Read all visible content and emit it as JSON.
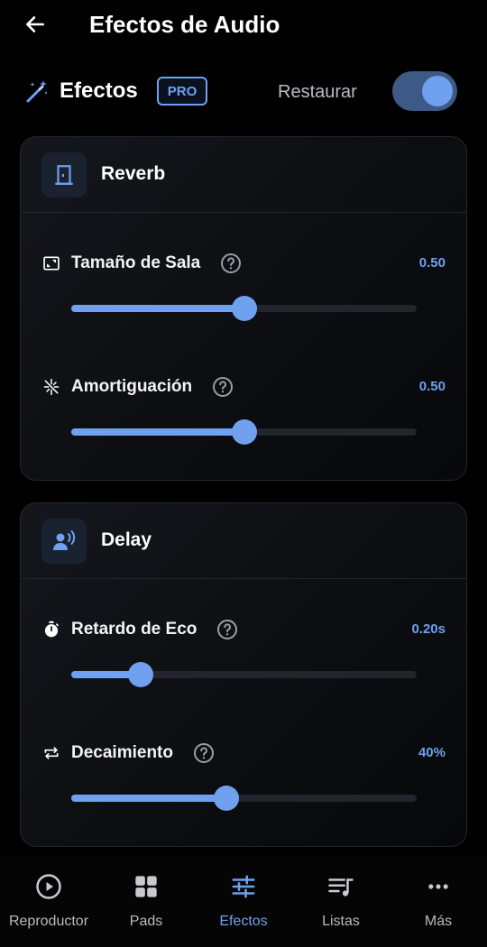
{
  "header": {
    "title": "Efectos de Audio",
    "back_icon": "arrow-left-icon"
  },
  "effects_bar": {
    "title": "Efectos",
    "badge": "PRO",
    "restore_label": "Restaurar",
    "toggle_on": true
  },
  "reverb": {
    "title": "Reverb",
    "params": [
      {
        "label": "Tamaño de Sala",
        "value": "0.50",
        "level": 0.5,
        "icon": "room-size-icon"
      },
      {
        "label": "Amortiguación",
        "value": "0.50",
        "level": 0.5,
        "icon": "damping-icon"
      }
    ]
  },
  "delay": {
    "title": "Delay",
    "params": [
      {
        "label": "Retardo de Eco",
        "value": "0.20s",
        "level": 0.2,
        "icon": "stopwatch-icon"
      },
      {
        "label": "Decaimiento",
        "value": "40%",
        "level": 0.45,
        "icon": "repeat-icon"
      }
    ]
  },
  "nav": {
    "items": [
      {
        "label": "Reproductor",
        "icon": "play-circle-icon",
        "active": false
      },
      {
        "label": "Pads",
        "icon": "grid-icon",
        "active": false
      },
      {
        "label": "Efectos",
        "icon": "sliders-icon",
        "active": true
      },
      {
        "label": "Listas",
        "icon": "playlist-icon",
        "active": false
      },
      {
        "label": "Más",
        "icon": "more-icon",
        "active": false
      }
    ]
  },
  "colors": {
    "accent": "#6fa1ef",
    "background": "#000000",
    "card": "#101318",
    "track": "#22252b"
  }
}
